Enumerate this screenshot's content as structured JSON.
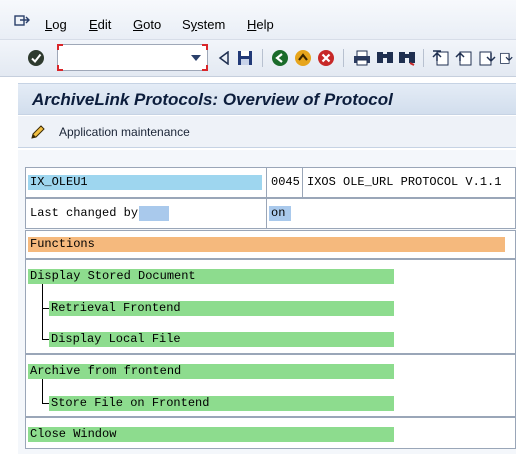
{
  "menu": {
    "items": [
      "Log",
      "Edit",
      "Goto",
      "System",
      "Help"
    ],
    "mnemonic_index": [
      0,
      0,
      0,
      1,
      0
    ]
  },
  "toolbar": {
    "command_field": {
      "value": "",
      "placeholder": ""
    },
    "icons": [
      "enter-icon",
      "back-nav-icon",
      "save-icon",
      "back-icon",
      "exit-icon",
      "cancel-icon",
      "print-icon",
      "find-icon",
      "find-next-icon",
      "first-page-icon",
      "previous-page-icon",
      "next-page-icon"
    ]
  },
  "title": "ArchiveLink Protocols: Overview of Protocol",
  "app_toolbar": {
    "button_label": "Application maintenance"
  },
  "header": {
    "protocol": "IX_OLEU1",
    "version": "0045",
    "description": "IXOS OLE_URL PROTOCOL V.1.1",
    "last_changed_label": "Last changed by",
    "last_changed_by": "",
    "last_changed_on_label": "on",
    "last_changed_on": ""
  },
  "functions_header": "Functions",
  "functions": {
    "display": {
      "label": "Display Stored Document",
      "children": [
        "Retrieval Frontend",
        "Display Local File"
      ]
    },
    "archive": {
      "label": "Archive from frontend",
      "children": [
        "Store File on Frontend"
      ]
    },
    "close": {
      "label": "Close Window"
    }
  },
  "colors": {
    "protocol_field": "#9ed6ef",
    "changed_field": "#a9c9ec",
    "functions_header": "#f5b97d",
    "function_item": "#8ddc8e",
    "title_text": "#0c1d3c"
  }
}
